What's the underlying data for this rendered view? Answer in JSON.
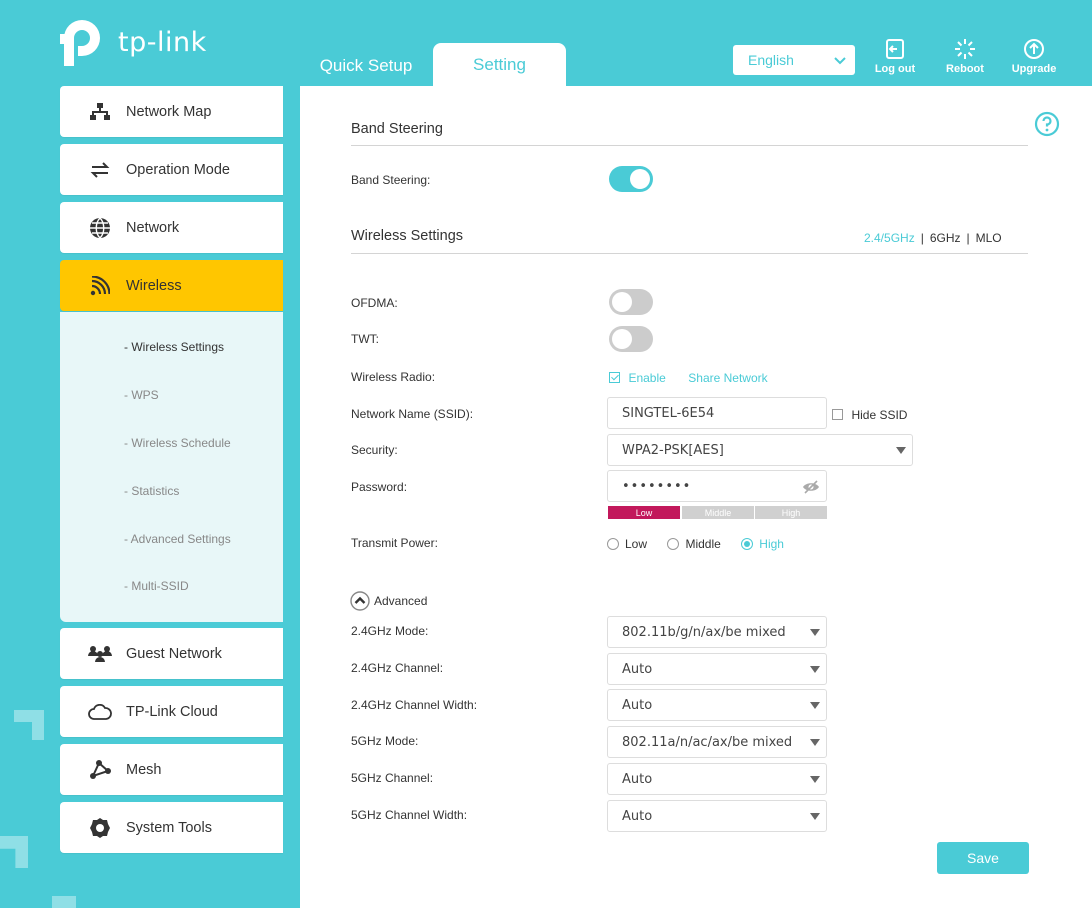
{
  "brand": {
    "logo_text": "tp-link"
  },
  "header": {
    "tabs": [
      {
        "label": "Quick Setup"
      },
      {
        "label": "Setting"
      }
    ],
    "language": "English",
    "buttons": [
      {
        "label": "Log out"
      },
      {
        "label": "Reboot"
      },
      {
        "label": "Upgrade"
      }
    ]
  },
  "sidebar": {
    "items": [
      {
        "label": "Network Map"
      },
      {
        "label": "Operation Mode"
      },
      {
        "label": "Network"
      },
      {
        "label": "Wireless"
      },
      {
        "label": "Guest Network"
      },
      {
        "label": "TP-Link Cloud"
      },
      {
        "label": "Mesh"
      },
      {
        "label": "System Tools"
      }
    ],
    "wireless_sub": [
      {
        "label": "- Wireless Settings"
      },
      {
        "label": "- WPS"
      },
      {
        "label": "- Wireless Schedule"
      },
      {
        "label": "- Statistics"
      },
      {
        "label": "- Advanced Settings"
      },
      {
        "label": "- Multi-SSID"
      }
    ]
  },
  "main": {
    "band_steering": {
      "title": "Band Steering",
      "label": "Band Steering:",
      "enabled": true
    },
    "wireless": {
      "title": "Wireless Settings",
      "band_tabs": {
        "a": "2.4/5GHz",
        "sep": "|",
        "b": "6GHz",
        "c": "MLO"
      },
      "ofdma_label": "OFDMA:",
      "twt_label": "TWT:",
      "radio_label": "Wireless Radio:",
      "radio_enable": "Enable",
      "share_network": "Share Network",
      "ssid_label": "Network Name (SSID):",
      "ssid_value": "SINGTEL-6E54",
      "hide_ssid": "Hide SSID",
      "security_label": "Security:",
      "security_value": "WPA2-PSK[AES]",
      "password_label": "Password:",
      "password_value": "••••••••",
      "strength": {
        "low": "Low",
        "middle": "Middle",
        "high": "High"
      },
      "power_label": "Transmit Power:",
      "power_options": {
        "low": "Low",
        "middle": "Middle",
        "high": "High"
      },
      "advanced_label": "Advanced",
      "mode24_label": "2.4GHz Mode:",
      "mode24_value": "802.11b/g/n/ax/be mixed",
      "ch24_label": "2.4GHz Channel:",
      "ch24_value": "Auto",
      "cw24_label": "2.4GHz Channel Width:",
      "cw24_value": "Auto",
      "mode5_label": "5GHz Mode:",
      "mode5_value": "802.11a/n/ac/ax/be mixed",
      "ch5_label": "5GHz Channel:",
      "ch5_value": "Auto",
      "cw5_label": "5GHz Channel Width:",
      "cw5_value": "Auto",
      "save": "Save"
    }
  },
  "colors": {
    "accent": "#4acbd6",
    "active_menu": "#ffc600",
    "strength_low": "#c2185b"
  }
}
